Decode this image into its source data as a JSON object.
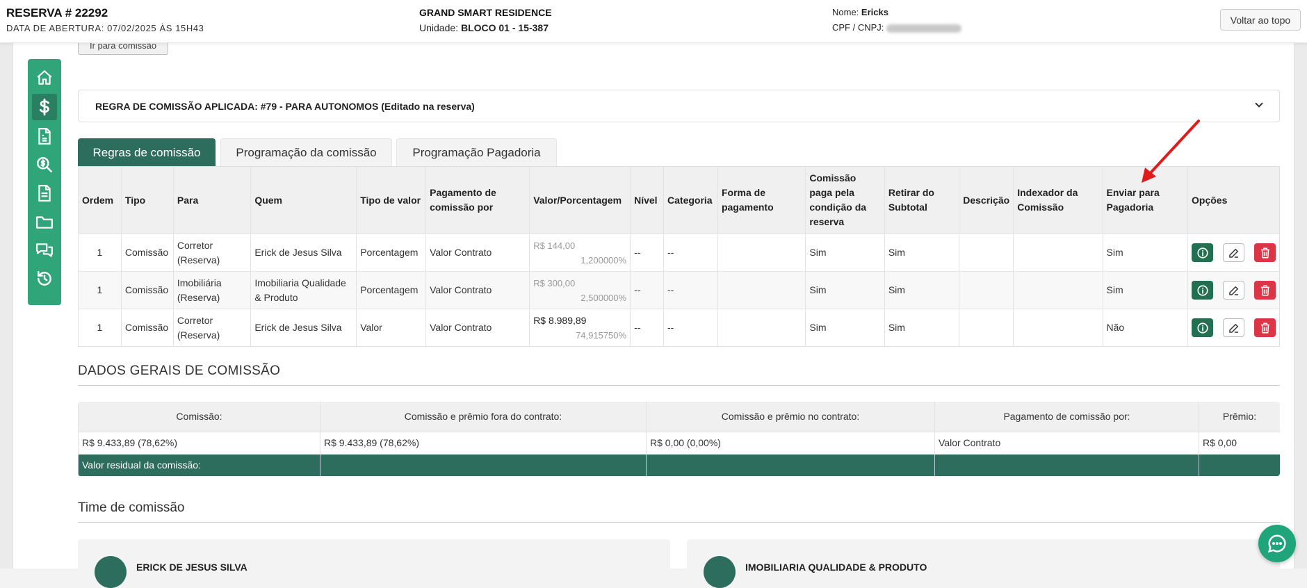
{
  "header": {
    "reserva": "RESERVA # 22292",
    "data_abertura": "DATA DE ABERTURA: 07/02/2025 ÀS 15H43",
    "empreendimento": "GRAND SMART RESIDENCE",
    "unidade_label": "Unidade:",
    "unidade_value": "BLOCO 01 - 15-387",
    "nome_label": "Nome:",
    "nome_value": "Ericks",
    "cpf_label": "CPF / CNPJ:",
    "voltar_label": "Voltar ao topo"
  },
  "ir_comissao_label": "Ir para comissão",
  "sidebar": {
    "items": [
      {
        "icon": "home-icon"
      },
      {
        "icon": "dollar-icon",
        "active": true
      },
      {
        "icon": "invoice-icon"
      },
      {
        "icon": "search-dollar-icon"
      },
      {
        "icon": "document-icon"
      },
      {
        "icon": "folder-icon"
      },
      {
        "icon": "chat-icon"
      },
      {
        "icon": "history-icon"
      }
    ]
  },
  "rule": {
    "title": "REGRA DE COMISSÃO APLICADA: #79 - PARA AUTONOMOS (Editado na reserva)"
  },
  "tabs": [
    {
      "label": "Regras de comissão",
      "active": true
    },
    {
      "label": "Programação da comissão"
    },
    {
      "label": "Programação Pagadoria"
    }
  ],
  "table": {
    "headers": [
      "Ordem",
      "Tipo",
      "Para",
      "Quem",
      "Tipo de valor",
      "Pagamento de comissão por",
      "Valor/Porcentagem",
      "Nível",
      "Categoria",
      "Forma de pagamento",
      "Comissão paga pela condição da reserva",
      "Retirar do Subtotal",
      "Descrição",
      "Indexador da Comissão",
      "Enviar para Pagadoria",
      "Opções"
    ],
    "rows": [
      {
        "ordem": "1",
        "tipo": "Comissão",
        "para": "Corretor (Reserva)",
        "quem": "Erick de Jesus Silva",
        "tipo_valor": "Porcentagem",
        "pagamento_por": "Valor Contrato",
        "valor": "R$ 144,00",
        "porcentagem": "1,200000%",
        "nivel": "--",
        "categoria": "--",
        "forma": "",
        "paga_condicao": "Sim",
        "retirar": "Sim",
        "descricao": "",
        "indexador": "",
        "enviar": "Sim"
      },
      {
        "ordem": "1",
        "tipo": "Comissão",
        "para": "Imobiliária (Reserva)",
        "quem": "Imobiliaria Qualidade & Produto",
        "tipo_valor": "Porcentagem",
        "pagamento_por": "Valor Contrato",
        "valor": "R$ 300,00",
        "porcentagem": "2,500000%",
        "nivel": "--",
        "categoria": "--",
        "forma": "",
        "paga_condicao": "Sim",
        "retirar": "Sim",
        "descricao": "",
        "indexador": "",
        "enviar": "Sim"
      },
      {
        "ordem": "1",
        "tipo": "Comissão",
        "para": "Corretor (Reserva)",
        "quem": "Erick de Jesus Silva",
        "tipo_valor": "Valor",
        "pagamento_por": "Valor Contrato",
        "valor": "R$ 8.989,89",
        "porcentagem": "74,915750%",
        "nivel": "--",
        "categoria": "--",
        "forma": "",
        "paga_condicao": "Sim",
        "retirar": "Sim",
        "descricao": "",
        "indexador": "",
        "enviar": "Não"
      }
    ]
  },
  "dados_gerais": {
    "title": "DADOS GERAIS DE COMISSÃO",
    "headers": [
      "Comissão:",
      "Comissão e prêmio fora do contrato:",
      "Comissão e prêmio no contrato:",
      "Pagamento de comissão por:",
      "Prêmio:"
    ],
    "values": [
      "R$ 9.433,89 (78,62%)",
      "R$ 9.433,89 (78,62%)",
      "R$ 0,00 (0,00%)",
      "Valor Contrato",
      "R$ 0,00"
    ],
    "residual_label": "Valor residual da comissão:"
  },
  "time": {
    "title": "Time de comissão",
    "members": [
      "ERICK DE JESUS SILVA",
      "IMOBILIARIA QUALIDADE & PRODUTO"
    ]
  },
  "colors": {
    "accent": "#2d6d5e",
    "sidebar": "#31a57a",
    "danger": "#dc3545",
    "arrow": "#e11b1b"
  }
}
